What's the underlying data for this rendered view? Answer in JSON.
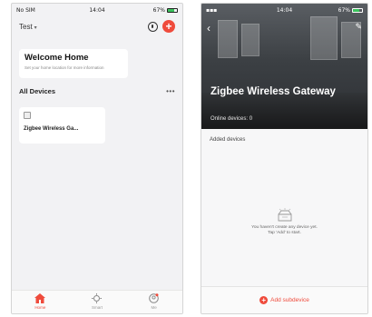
{
  "left_screen": {
    "status": {
      "carrier": "No SIM",
      "time": "14:04",
      "battery": "67%"
    },
    "home_name": "Test",
    "welcome": {
      "title": "Welcome Home",
      "subtitle": "Set your home location for more information"
    },
    "devices_title": "All Devices",
    "more_icon": "•••",
    "devices": [
      {
        "name": "Zigbee Wireless Ga..."
      }
    ],
    "tabs": [
      {
        "label": "Home",
        "icon": "home-icon",
        "active": true
      },
      {
        "label": "Smart",
        "icon": "smart-icon",
        "active": false
      },
      {
        "label": "Me",
        "icon": "me-icon",
        "active": false
      }
    ]
  },
  "right_screen": {
    "status": {
      "time": "14:04",
      "battery": "67%"
    },
    "title": "Zigbee Wireless Gateway",
    "online_devices": "Online devices: 0",
    "added_devices_label": "Added devices",
    "empty_line1": "You haven't create any device yet.",
    "empty_line2": "Tap 'Add' to start.",
    "add_subdevice": "Add subdevice"
  },
  "colors": {
    "accent": "#ef4b3c",
    "background": "#f2f2f4"
  }
}
